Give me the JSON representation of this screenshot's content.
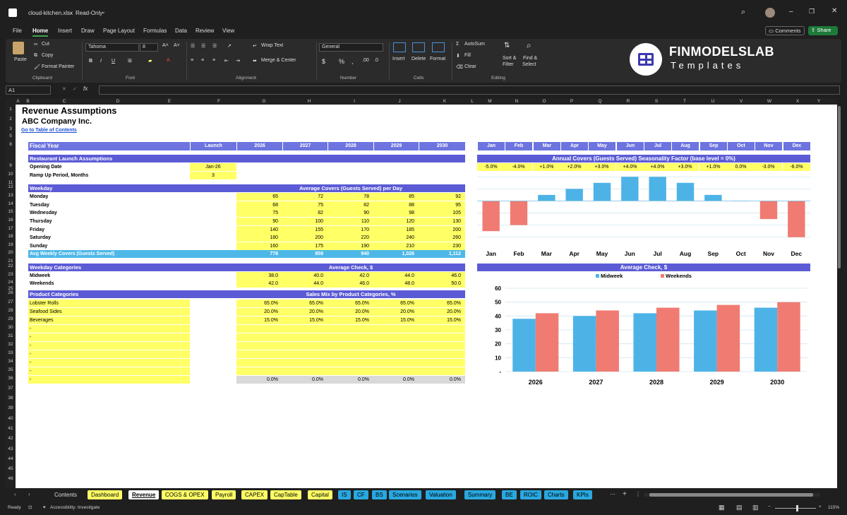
{
  "window": {
    "filename": "cloud-kitchen.xlsx",
    "mode": "Read-Only"
  },
  "menu": [
    "File",
    "Home",
    "Insert",
    "Draw",
    "Page Layout",
    "Formulas",
    "Data",
    "Review",
    "View"
  ],
  "menu_right": {
    "comments": "Comments",
    "share": "Share"
  },
  "ribbon": {
    "clipboard": {
      "paste": "Paste",
      "cut": "Cut",
      "copy": "Copy",
      "format_painter": "Format Painter",
      "label": "Clipboard"
    },
    "font": {
      "name": "Tahoma",
      "size": "8",
      "label": "Font"
    },
    "alignment": {
      "wrap": "Wrap Text",
      "merge": "Merge & Center",
      "label": "Alignment"
    },
    "number": {
      "format": "General",
      "label": "Number"
    },
    "cells": {
      "insert": "Insert",
      "delete": "Delete",
      "format": "Format",
      "label": "Cells"
    },
    "editing": {
      "autosum": "AutoSum",
      "fill": "Fill",
      "clear": "Clear",
      "sort": "Sort &",
      "filter": "Filter",
      "find": "Find &",
      "select": "Select",
      "label": "Editing"
    },
    "logo": {
      "brand": "FINMODELSLAB",
      "sub": "Templates"
    }
  },
  "formula_bar": {
    "cell_ref": "A1",
    "fx": "fx"
  },
  "columns": [
    "A",
    "B",
    "C",
    "D",
    "E",
    "F",
    "G",
    "H",
    "I",
    "J",
    "K",
    "L",
    "M",
    "N",
    "O",
    "P",
    "Q",
    "R",
    "S",
    "T",
    "U",
    "V",
    "W",
    "X",
    "Y"
  ],
  "rows": [
    "1",
    "2",
    "3",
    "5",
    "8",
    "9",
    "10",
    "11",
    "12",
    "13",
    "14",
    "15",
    "16",
    "17",
    "18",
    "19",
    "20",
    "21",
    "22",
    "23",
    "24",
    "25",
    "26",
    "27",
    "28",
    "29",
    "30",
    "31",
    "32",
    "33",
    "34",
    "35",
    "36",
    "37",
    "38",
    "39",
    "40",
    "41",
    "42",
    "43",
    "44",
    "45",
    "46"
  ],
  "sheet": {
    "title": "Revenue Assumptions",
    "company": "ABC Company Inc.",
    "link": "Go to Table of Contents",
    "fiscal_year": "Fiscal Year",
    "years": [
      "Launch",
      "2026",
      "2027",
      "2028",
      "2029",
      "2030"
    ],
    "launch_section": "Restaurant Launch Assumptions",
    "opening_date_label": "Opening Date",
    "opening_date": "Jan-26",
    "ramp_label": "Ramp Up Period, Months",
    "ramp": "3",
    "weekday_header": "Weekday",
    "covers_header": "Average Covers (Guests Served) per Day",
    "weekdays": [
      {
        "day": "Monday",
        "v": [
          "65",
          "72",
          "78",
          "85",
          "92"
        ]
      },
      {
        "day": "Tuesday",
        "v": [
          "68",
          "75",
          "82",
          "88",
          "95"
        ]
      },
      {
        "day": "Wednesday",
        "v": [
          "75",
          "82",
          "90",
          "98",
          "105"
        ]
      },
      {
        "day": "Thursday",
        "v": [
          "90",
          "100",
          "110",
          "120",
          "130"
        ]
      },
      {
        "day": "Friday",
        "v": [
          "140",
          "155",
          "170",
          "185",
          "200"
        ]
      },
      {
        "day": "Saturday",
        "v": [
          "180",
          "200",
          "220",
          "240",
          "260"
        ]
      },
      {
        "day": "Sunday",
        "v": [
          "160",
          "175",
          "190",
          "210",
          "230"
        ]
      }
    ],
    "avg_weekly_label": "Avg Weekly Covers (Guests Served)",
    "avg_weekly": [
      "778",
      "859",
      "940",
      "1,026",
      "1,112"
    ],
    "weekday_cat_header": "Weekday Categories",
    "avg_check_header": "Average Check, $",
    "weekday_cats": [
      {
        "name": "Midweek",
        "v": [
          "38.0",
          "40.0",
          "42.0",
          "44.0",
          "46.0"
        ]
      },
      {
        "name": "Weekends",
        "v": [
          "42.0",
          "44.0",
          "46.0",
          "48.0",
          "50.0"
        ]
      }
    ],
    "product_header": "Product Categories",
    "sales_mix_header": "Sales Mix by Product Categories, %",
    "products": [
      {
        "name": "Lobster Rolls",
        "v": [
          "65.0%",
          "65.0%",
          "65.0%",
          "65.0%",
          "65.0%"
        ]
      },
      {
        "name": "Seafood Sides",
        "v": [
          "20.0%",
          "20.0%",
          "20.0%",
          "20.0%",
          "20.0%"
        ]
      },
      {
        "name": "Beverages",
        "v": [
          "15.0%",
          "15.0%",
          "15.0%",
          "15.0%",
          "15.0%"
        ]
      },
      {
        "name": "-",
        "v": [
          "",
          "",
          "",
          "",
          ""
        ]
      },
      {
        "name": "-",
        "v": [
          "",
          "",
          "",
          "",
          ""
        ]
      },
      {
        "name": "-",
        "v": [
          "",
          "",
          "",
          "",
          ""
        ]
      },
      {
        "name": "-",
        "v": [
          "",
          "",
          "",
          "",
          ""
        ]
      },
      {
        "name": "-",
        "v": [
          "",
          "",
          "",
          "",
          ""
        ]
      },
      {
        "name": "-",
        "v": [
          "",
          "",
          "",
          "",
          ""
        ]
      },
      {
        "name": "-",
        "v": [
          "0.0%",
          "0.0%",
          "0.0%",
          "0.0%",
          "0.0%"
        ]
      }
    ],
    "months": [
      "Jan",
      "Feb",
      "Mar",
      "Apr",
      "May",
      "Jun",
      "Jul",
      "Aug",
      "Sep",
      "Oct",
      "Nov",
      "Dec"
    ],
    "seasonality_header": "Annual Covers (Guests Served) Seasonality Factor (base level = 0%)",
    "seasonality_labels": [
      "-5.0%",
      "-4.0%",
      "+1.0%",
      "+2.0%",
      "+3.0%",
      "+4.0%",
      "+4.0%",
      "+3.0%",
      "+1.0%",
      "0.0%",
      "-3.0%",
      "-6.0%"
    ],
    "avg_check_chart_header": "Average Check, $"
  },
  "chart_data": [
    {
      "type": "bar",
      "categories": [
        "Jan",
        "Feb",
        "Mar",
        "Apr",
        "May",
        "Jun",
        "Jul",
        "Aug",
        "Sep",
        "Oct",
        "Nov",
        "Dec"
      ],
      "values": [
        -5.0,
        -4.0,
        1.0,
        2.0,
        3.0,
        4.0,
        4.0,
        3.0,
        1.0,
        0.0,
        -3.0,
        -6.0
      ],
      "ylim": [
        -6.5,
        4.5
      ],
      "colors": {
        "positive": "#4db3e6",
        "negative": "#f07b72"
      }
    },
    {
      "type": "bar",
      "categories": [
        "2026",
        "2027",
        "2028",
        "2029",
        "2030"
      ],
      "series": [
        {
          "name": "Midweek",
          "values": [
            38,
            40,
            42,
            44,
            46
          ],
          "color": "#4db3e6"
        },
        {
          "name": "Weekends",
          "values": [
            42,
            44,
            46,
            48,
            50
          ],
          "color": "#f07b72"
        }
      ],
      "yticks": [
        "60",
        "50",
        "40",
        "30",
        "20",
        "10",
        "-"
      ],
      "ylim": [
        0,
        60
      ],
      "legend": "top"
    }
  ],
  "tabs": [
    {
      "label": "Contents",
      "bg": "#1f1f1f",
      "fg": "#ddd"
    },
    {
      "label": "Dashboard",
      "bg": "#ffff66"
    },
    {
      "label": "Revenue",
      "bg": "#ffffff"
    },
    {
      "label": "COGS & OPEX",
      "bg": "#ffff66"
    },
    {
      "label": "Payroll",
      "bg": "#ffff66"
    },
    {
      "label": "CAPEX",
      "bg": "#ffff66"
    },
    {
      "label": "CapTable",
      "bg": "#ffff66"
    },
    {
      "label": "Capital",
      "bg": "#ffff66"
    },
    {
      "label": "IS",
      "bg": "#29a8e0"
    },
    {
      "label": "CF",
      "bg": "#29a8e0"
    },
    {
      "label": "BS",
      "bg": "#29a8e0"
    },
    {
      "label": "Scenarios",
      "bg": "#29a8e0"
    },
    {
      "label": "Valuation",
      "bg": "#29a8e0"
    },
    {
      "label": "Summary",
      "bg": "#29a8e0"
    },
    {
      "label": "BE",
      "bg": "#29a8e0"
    },
    {
      "label": "ROIC",
      "bg": "#29a8e0"
    },
    {
      "label": "Charts",
      "bg": "#29a8e0"
    },
    {
      "label": "KPIs",
      "bg": "#29a8e0"
    }
  ],
  "status": {
    "ready": "Ready",
    "accessibility": "Accessibility: Investigate",
    "zoom": "115%"
  }
}
